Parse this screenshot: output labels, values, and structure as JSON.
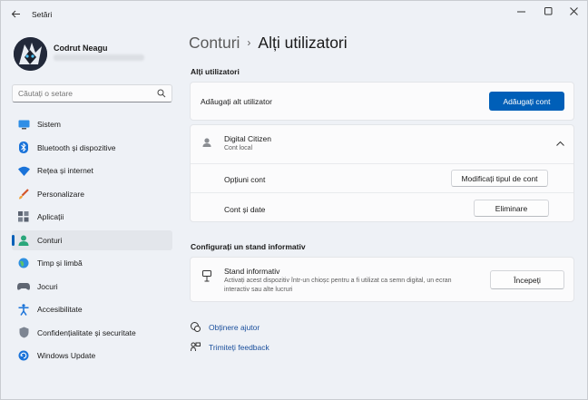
{
  "app": {
    "title": "Setări"
  },
  "profile": {
    "name": "Codrut Neagu"
  },
  "search": {
    "placeholder": "Căutați o setare"
  },
  "nav": [
    {
      "label": "Sistem",
      "icon": "system-icon"
    },
    {
      "label": "Bluetooth și dispozitive",
      "icon": "bluetooth-icon"
    },
    {
      "label": "Rețea și internet",
      "icon": "wifi-icon"
    },
    {
      "label": "Personalizare",
      "icon": "brush-icon"
    },
    {
      "label": "Aplicații",
      "icon": "apps-icon"
    },
    {
      "label": "Conturi",
      "icon": "accounts-icon",
      "active": true
    },
    {
      "label": "Timp și limbă",
      "icon": "globe-icon"
    },
    {
      "label": "Jocuri",
      "icon": "gamepad-icon"
    },
    {
      "label": "Accesibilitate",
      "icon": "accessibility-icon"
    },
    {
      "label": "Confidențialitate și securitate",
      "icon": "shield-icon"
    },
    {
      "label": "Windows Update",
      "icon": "update-icon"
    }
  ],
  "breadcrumb": {
    "parent": "Conturi",
    "separator": "›",
    "current": "Alți utilizatori"
  },
  "other_users": {
    "section_title": "Alți utilizatori",
    "add_label": "Adăugați alt utilizator",
    "add_button": "Adăugați cont",
    "user": {
      "name": "Digital Citizen",
      "type": "Cont local",
      "options_label": "Opțiuni cont",
      "options_button": "Modificați tipul de cont",
      "data_label": "Cont și date",
      "remove_button": "Eliminare"
    }
  },
  "kiosk": {
    "section_title": "Configurați un stand informativ",
    "title": "Stand informativ",
    "description": "Activați acest dispozitiv într-un chioșc pentru a fi utilizat ca semn digital, un ecran interactiv sau alte lucruri",
    "button": "Începeți"
  },
  "links": {
    "help": "Obținere ajutor",
    "feedback": "Trimiteți feedback"
  },
  "colors": {
    "accent": "#005fb8",
    "background": "#eef1f6",
    "card": "#fbfbfc"
  }
}
